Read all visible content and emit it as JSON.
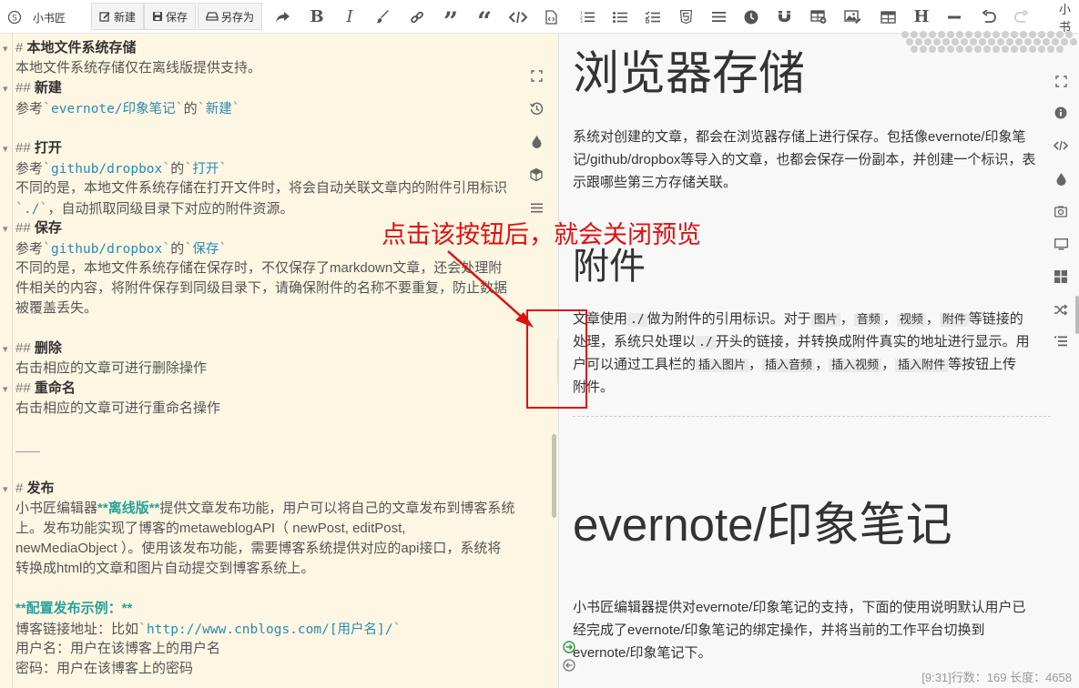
{
  "toolbar": {
    "logo_text": "小书匠",
    "new_label": "新建",
    "save_label": "保存",
    "saveas_label": "另存为",
    "right_cut_text": "小书"
  },
  "editor": {
    "lines": [
      {
        "kind": "h",
        "mark": "#",
        "text": "本地文件系统存储"
      },
      {
        "kind": "t",
        "text": "本地文件系统存储仅在离线版提供支持。"
      },
      {
        "kind": "h",
        "mark": "##",
        "text": "新建"
      },
      {
        "kind": "ref",
        "pre": "参考",
        "c1": "evernote/印象笔记",
        "mid": "的",
        "c2": "新建"
      },
      {
        "kind": "h",
        "mark": "##",
        "text": "打开"
      },
      {
        "kind": "ref",
        "pre": "参考",
        "c1": "github/dropbox",
        "mid": "的",
        "c2": "打开"
      },
      {
        "kind": "t",
        "text": "不同的是，本地文件系统存储在打开文件时，将会自动关联文章内的附件引用标识"
      },
      {
        "kind": "code_t",
        "code": "./",
        "text": "，自动抓取同级目录下对应的附件资源。"
      },
      {
        "kind": "h",
        "mark": "##",
        "text": "保存"
      },
      {
        "kind": "ref",
        "pre": "参考",
        "c1": "github/dropbox",
        "mid": "的",
        "c2": "保存"
      },
      {
        "kind": "t",
        "text": "不同的是，本地文件系统存储在保存时，不仅保存了markdown文章，还会处理附"
      },
      {
        "kind": "t",
        "text": "件相关的内容，将附件保存到同级目录下，请确保附件的名称不要重复，防止数据"
      },
      {
        "kind": "t",
        "text": "被覆盖丢失。"
      },
      {
        "kind": "h",
        "mark": "##",
        "text": "删除"
      },
      {
        "kind": "t",
        "text": "右击相应的文章可进行删除操作"
      },
      {
        "kind": "h",
        "mark": "##",
        "text": "重命名"
      },
      {
        "kind": "t",
        "text": "右击相应的文章可进行重命名操作"
      },
      {
        "kind": "h",
        "mark": "#",
        "text": "发布"
      },
      {
        "kind": "pub",
        "pre": "小书匠编辑器",
        "strong": "**离线版**",
        "text": "提供文章发布功能，用户可以将自己的文章发布到博客系统"
      },
      {
        "kind": "t",
        "text": "上。发布功能实现了博客的metaweblogAPI（ newPost, editPost,"
      },
      {
        "kind": "t",
        "text": "newMediaObject ）。使用该发布功能，需要博客系统提供对应的api接口，系统将"
      },
      {
        "kind": "t",
        "text": "转换成html的文章和图片自动提交到博客系统上。"
      },
      {
        "kind": "strong",
        "text": "**配置发布示例：**"
      },
      {
        "kind": "url",
        "pre": "博客链接地址：比如",
        "code": "http://www.cnblogs.com/[用户名]/"
      },
      {
        "kind": "t",
        "text": "用户名：用户在该博客上的用户名"
      },
      {
        "kind": "t",
        "text": "密码：用户在该博客上的密码"
      }
    ]
  },
  "preview": {
    "h1_storage": "浏览器存储",
    "p_storage_1": "系统对创建的文章，都会在浏览器存储上进行保存。包括像evernote/印象笔",
    "p_storage_2": "记/github/dropbox等导入的文章，也都会保存一份副本，并创建一个标识，表",
    "p_storage_3": "示跟哪些第三方存储关联。",
    "h1_attach": "附件",
    "p_attach_1_a": "文章使用",
    "p_attach_1_code": "./",
    "p_attach_1_b": "做为附件的引用标识。对于",
    "code_image": "图片",
    "code_audio": "音频",
    "code_video": "视频",
    "code_attach": "附件",
    "p_attach_1_c": "等链接的",
    "sep": "，",
    "p_attach_2_a": "处理，系统只处理以",
    "p_attach_2_code": "./",
    "p_attach_2_b": "开头的链接，并转换成附件真实的地址进行显示。用",
    "p_attach_3_a": "户可以通过工具栏的",
    "code_ins_image": "插入图片",
    "code_ins_audio": "插入音频",
    "code_ins_video": "插入视频",
    "code_ins_attach": "插入附件",
    "p_attach_3_b": "等按钮上传",
    "p_attach_4": "附件。",
    "h1_evernote": "evernote/印象笔记",
    "p_ever_1": "小书匠编辑器提供对evernote/印象笔记的支持，下面的使用说明默认用户已",
    "p_ever_2": "经完成了evernote/印象笔记的绑定操作，并将当前的工作平台切换到",
    "p_ever_3": "evernote/印象笔记下。"
  },
  "status": "[9:31]行数：169 长度：4658",
  "callout": "点击该按钮后，就会关闭预览",
  "colors": {
    "accent": "#e01010",
    "editor_bg": "#fdf6e3",
    "preview_bg": "#f8f8f8",
    "link": "#2a8ab5",
    "strong": "#2aa198"
  }
}
